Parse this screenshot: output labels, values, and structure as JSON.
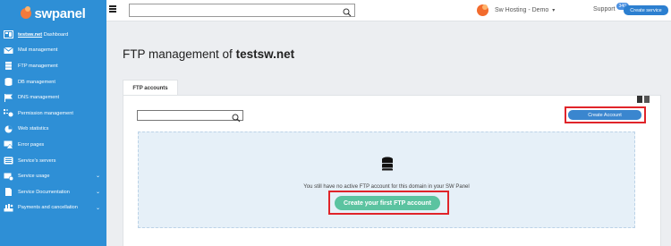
{
  "brand": {
    "name": "swpanel"
  },
  "sidebar": {
    "items": [
      {
        "label_bold": "testsw.net",
        "label": "Dashboard",
        "icon": "dashboard-icon"
      },
      {
        "label": "Mail management",
        "icon": "mail-icon"
      },
      {
        "label": "FTP management",
        "icon": "server-icon"
      },
      {
        "label": "DB management",
        "icon": "database-icon"
      },
      {
        "label": "DNS management",
        "icon": "flag-icon"
      },
      {
        "label": "Permission management",
        "icon": "permissions-icon"
      },
      {
        "label": "Web statistics",
        "icon": "pie-chart-icon"
      },
      {
        "label": "Error pages",
        "icon": "warning-page-icon"
      },
      {
        "label": "Service's servers",
        "icon": "servers-icon"
      },
      {
        "label": "Service usage",
        "icon": "usage-icon",
        "has_caret": true
      },
      {
        "label": "Service Documentation",
        "icon": "document-icon",
        "has_caret": true
      },
      {
        "label": "Payments and cancellation",
        "icon": "payments-icon",
        "has_caret": true
      }
    ]
  },
  "topbar": {
    "search_placeholder": "",
    "account": "Sw Hosting - Demo",
    "support": "Support",
    "support_badge": "340",
    "create_service": "Create service"
  },
  "main": {
    "title_prefix": "FTP management of",
    "title_domain": "testsw.net",
    "tabs": [
      "FTP accounts"
    ],
    "search_placeholder": "",
    "create_account": "Create Account",
    "empty_message": "You still have no active FTP account for this domain in your SW Panel",
    "create_first": "Create your first FTP account"
  },
  "colors": {
    "sidebar": "#2e8fd6",
    "primary_button": "#3a86cf",
    "success_button": "#5bc3a0",
    "highlight": "#e0242a",
    "empty_bg": "#e6f0f8"
  }
}
